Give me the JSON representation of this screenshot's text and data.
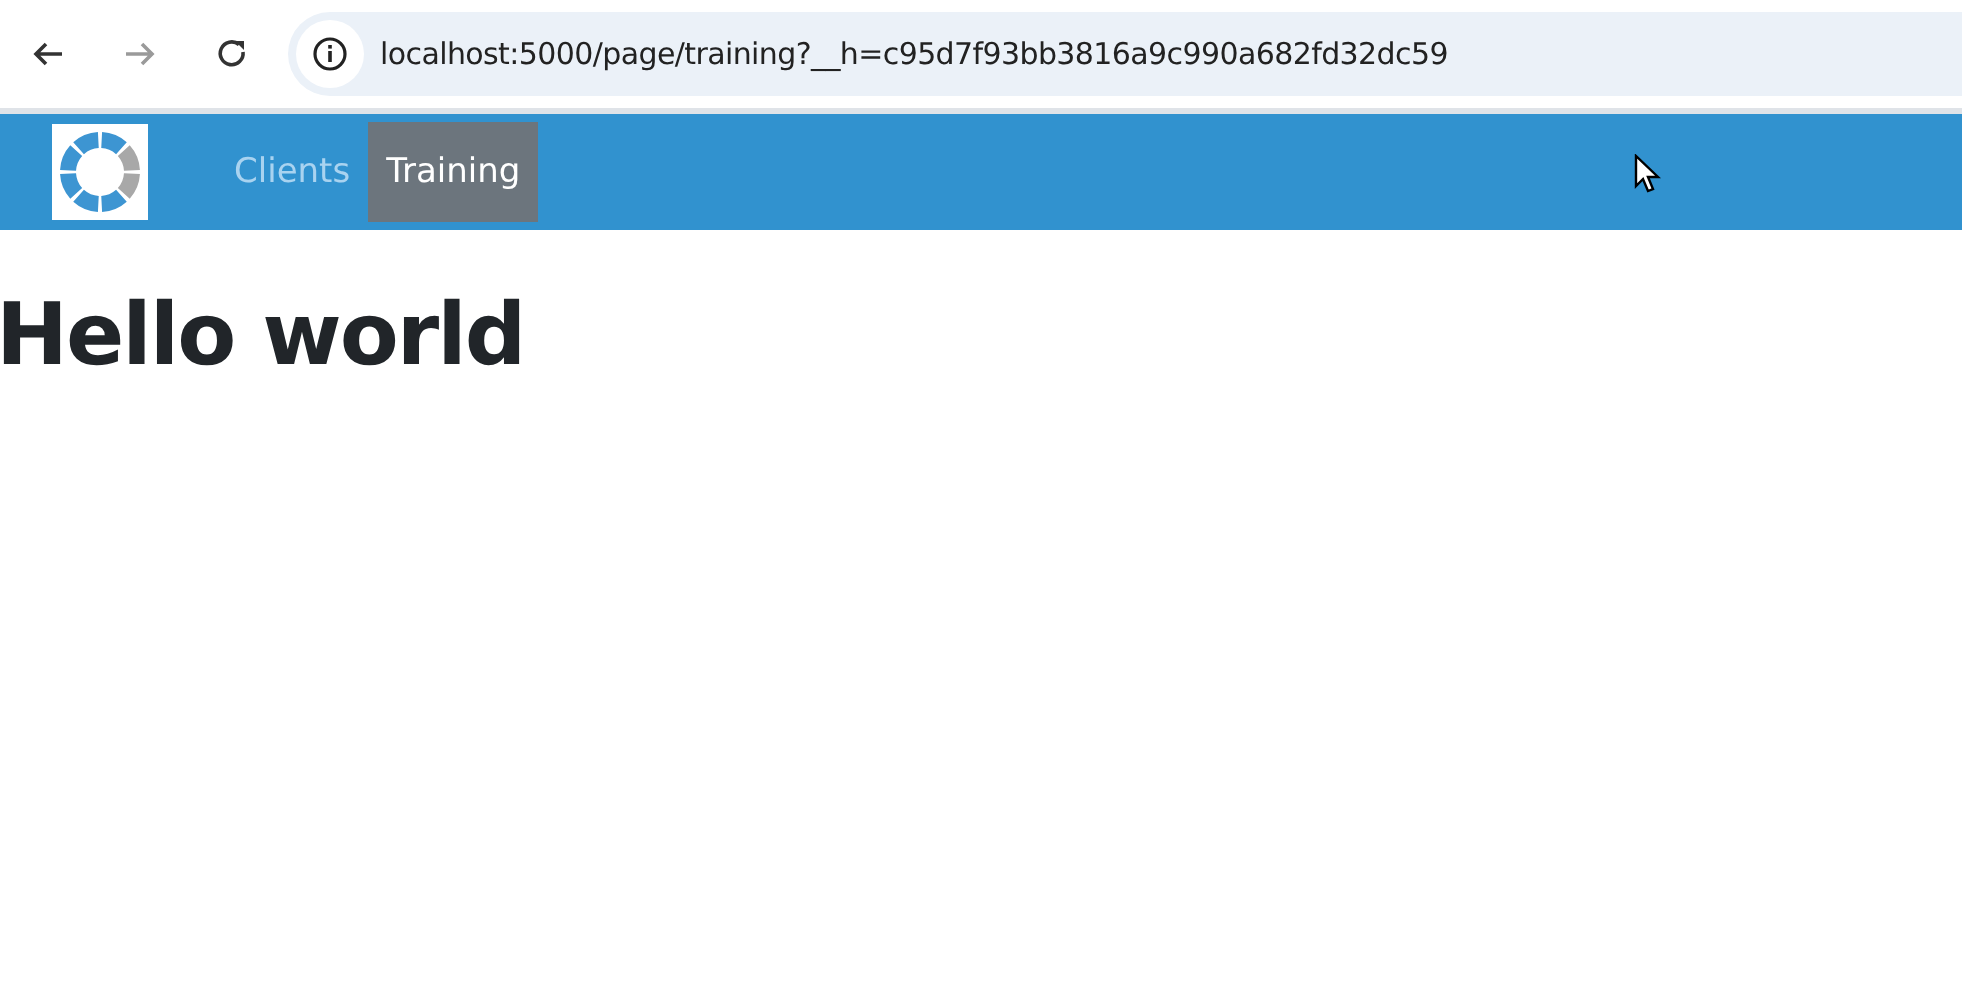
{
  "browser": {
    "url": "localhost:5000/page/training?__h=c95d7f93bb3816a9c990a682fd32dc59",
    "buttons": [
      {
        "kind": "back",
        "disabled": false
      },
      {
        "kind": "forward",
        "disabled": true
      },
      {
        "kind": "reload",
        "disabled": false
      }
    ]
  },
  "navbar": {
    "items": [
      {
        "label": "Clients",
        "selected": false
      },
      {
        "label": "Training",
        "selected": true
      }
    ]
  },
  "heading": "Hello world"
}
